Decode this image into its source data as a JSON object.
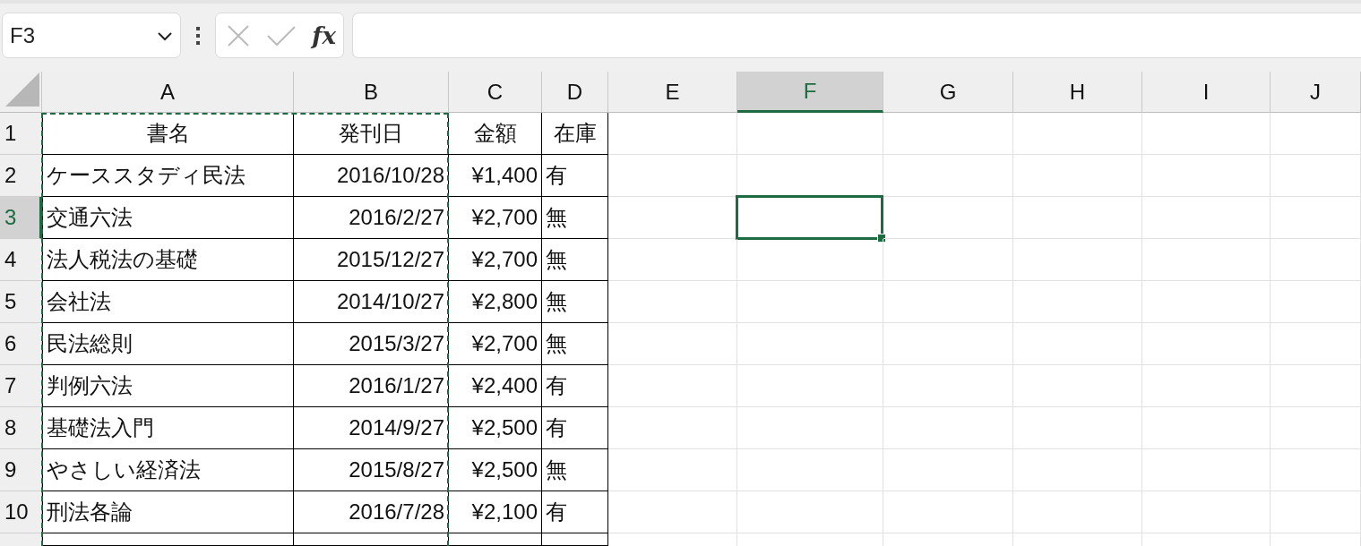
{
  "formula_bar": {
    "name_box": "F3",
    "function_button": "fx"
  },
  "columns": [
    {
      "label": "A",
      "selected": false,
      "copied": true
    },
    {
      "label": "B",
      "selected": false,
      "copied": true
    },
    {
      "label": "C",
      "selected": false,
      "copied": false
    },
    {
      "label": "D",
      "selected": false,
      "copied": false
    },
    {
      "label": "E",
      "selected": false,
      "copied": false
    },
    {
      "label": "F",
      "selected": true,
      "copied": false
    },
    {
      "label": "G",
      "selected": false,
      "copied": false
    },
    {
      "label": "H",
      "selected": false,
      "copied": false
    },
    {
      "label": "I",
      "selected": false,
      "copied": false
    },
    {
      "label": "J",
      "selected": false,
      "copied": false
    }
  ],
  "rows": [
    {
      "number": "1",
      "selected": false,
      "cells": [
        "書名",
        "発刊日",
        "金額",
        "在庫"
      ]
    },
    {
      "number": "2",
      "selected": false,
      "cells": [
        "ケーススタディ民法",
        "2016/10/28",
        "¥1,400",
        "有"
      ]
    },
    {
      "number": "3",
      "selected": true,
      "cells": [
        "交通六法",
        "2016/2/27",
        "¥2,700",
        "無"
      ]
    },
    {
      "number": "4",
      "selected": false,
      "cells": [
        "法人税法の基礎",
        "2015/12/27",
        "¥2,700",
        "無"
      ]
    },
    {
      "number": "5",
      "selected": false,
      "cells": [
        "会社法",
        "2014/10/27",
        "¥2,800",
        "無"
      ]
    },
    {
      "number": "6",
      "selected": false,
      "cells": [
        "民法総則",
        "2015/3/27",
        "¥2,700",
        "無"
      ]
    },
    {
      "number": "7",
      "selected": false,
      "cells": [
        "判例六法",
        "2016/1/27",
        "¥2,400",
        "有"
      ]
    },
    {
      "number": "8",
      "selected": false,
      "cells": [
        "基礎法入門",
        "2014/9/27",
        "¥2,500",
        "有"
      ]
    },
    {
      "number": "9",
      "selected": false,
      "cells": [
        "やさしい経済法",
        "2015/8/27",
        "¥2,500",
        "無"
      ]
    },
    {
      "number": "10",
      "selected": false,
      "cells": [
        "刑法各論",
        "2016/7/28",
        "¥2,100",
        "有"
      ]
    }
  ]
}
